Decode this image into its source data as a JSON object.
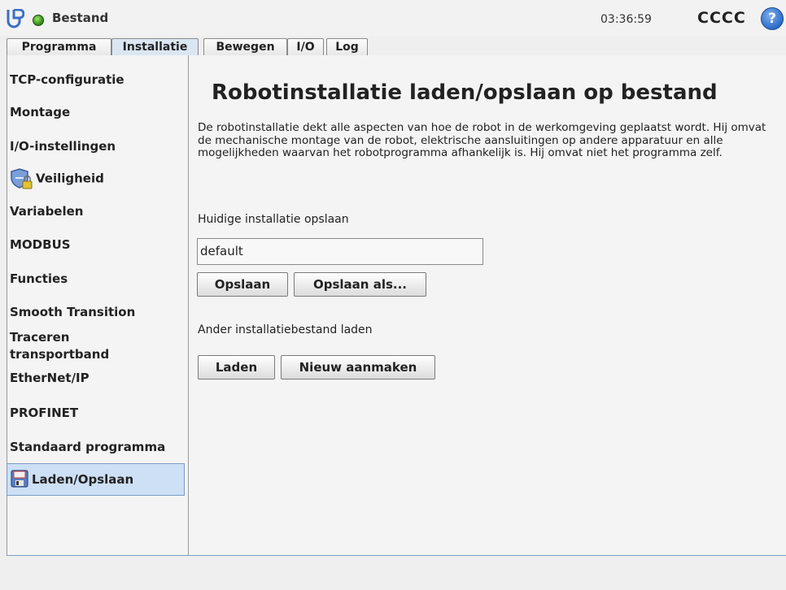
{
  "header": {
    "app_title": "Bestand",
    "clock": "03:36:59",
    "robot_name": "CCCC",
    "help_symbol": "?"
  },
  "tabs": [
    {
      "label": "Programma"
    },
    {
      "label": "Installatie"
    },
    {
      "label": "Bewegen"
    },
    {
      "label": "I/O"
    },
    {
      "label": "Log"
    }
  ],
  "active_tab": "Installatie",
  "sidebar": {
    "items": [
      {
        "label": "TCP-configuratie"
      },
      {
        "label": "Montage"
      },
      {
        "label": "I/O-instellingen"
      },
      {
        "label": "Veiligheid",
        "icon": "shield-lock-icon"
      },
      {
        "label": "Variabelen"
      },
      {
        "label": "MODBUS"
      },
      {
        "label": "Functies"
      },
      {
        "label": "Smooth Transition"
      },
      {
        "label": "Traceren transportband"
      },
      {
        "label": "EtherNet/IP"
      },
      {
        "label": "PROFINET"
      },
      {
        "label": "Standaard programma"
      },
      {
        "label": "Laden/Opslaan",
        "icon": "floppy-disk-icon"
      }
    ],
    "selected": "Laden/Opslaan"
  },
  "main": {
    "title": "Robotinstallatie laden/opslaan op bestand",
    "description": "De robotinstallatie dekt alle aspecten van hoe de robot in de werkomgeving geplaatst wordt. Hij omvat de mechanische montage van de robot, elektrische aansluitingen op andere apparatuur en alle mogelijkheden waarvan het robotprogramma afhankelijk is. Hij omvat niet het programma zelf.",
    "save_section_label": "Huidige installatie opslaan",
    "installation_name": "default",
    "save_button": "Opslaan",
    "save_as_button": "Opslaan als...",
    "load_section_label": "Ander installatiebestand laden",
    "load_button": "Laden",
    "new_button": "Nieuw aanmaken"
  },
  "colors": {
    "selected_bg": "#cde0f5",
    "active_tab_bg": "#dbe6f3",
    "status_green": "#3d9a1f",
    "help_blue": "#2d6cc9"
  }
}
